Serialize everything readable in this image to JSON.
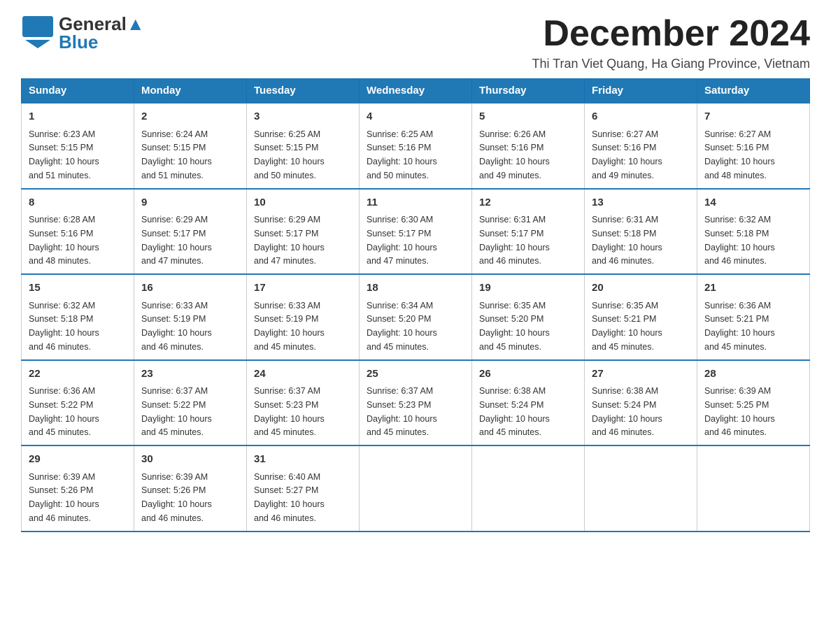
{
  "logo": {
    "general": "General",
    "blue": "Blue"
  },
  "header": {
    "month_title": "December 2024",
    "location": "Thi Tran Viet Quang, Ha Giang Province, Vietnam"
  },
  "weekdays": [
    "Sunday",
    "Monday",
    "Tuesday",
    "Wednesday",
    "Thursday",
    "Friday",
    "Saturday"
  ],
  "weeks": [
    [
      {
        "day": "1",
        "sunrise": "6:23 AM",
        "sunset": "5:15 PM",
        "daylight": "10 hours and 51 minutes."
      },
      {
        "day": "2",
        "sunrise": "6:24 AM",
        "sunset": "5:15 PM",
        "daylight": "10 hours and 51 minutes."
      },
      {
        "day": "3",
        "sunrise": "6:25 AM",
        "sunset": "5:15 PM",
        "daylight": "10 hours and 50 minutes."
      },
      {
        "day": "4",
        "sunrise": "6:25 AM",
        "sunset": "5:16 PM",
        "daylight": "10 hours and 50 minutes."
      },
      {
        "day": "5",
        "sunrise": "6:26 AM",
        "sunset": "5:16 PM",
        "daylight": "10 hours and 49 minutes."
      },
      {
        "day": "6",
        "sunrise": "6:27 AM",
        "sunset": "5:16 PM",
        "daylight": "10 hours and 49 minutes."
      },
      {
        "day": "7",
        "sunrise": "6:27 AM",
        "sunset": "5:16 PM",
        "daylight": "10 hours and 48 minutes."
      }
    ],
    [
      {
        "day": "8",
        "sunrise": "6:28 AM",
        "sunset": "5:16 PM",
        "daylight": "10 hours and 48 minutes."
      },
      {
        "day": "9",
        "sunrise": "6:29 AM",
        "sunset": "5:17 PM",
        "daylight": "10 hours and 47 minutes."
      },
      {
        "day": "10",
        "sunrise": "6:29 AM",
        "sunset": "5:17 PM",
        "daylight": "10 hours and 47 minutes."
      },
      {
        "day": "11",
        "sunrise": "6:30 AM",
        "sunset": "5:17 PM",
        "daylight": "10 hours and 47 minutes."
      },
      {
        "day": "12",
        "sunrise": "6:31 AM",
        "sunset": "5:17 PM",
        "daylight": "10 hours and 46 minutes."
      },
      {
        "day": "13",
        "sunrise": "6:31 AM",
        "sunset": "5:18 PM",
        "daylight": "10 hours and 46 minutes."
      },
      {
        "day": "14",
        "sunrise": "6:32 AM",
        "sunset": "5:18 PM",
        "daylight": "10 hours and 46 minutes."
      }
    ],
    [
      {
        "day": "15",
        "sunrise": "6:32 AM",
        "sunset": "5:18 PM",
        "daylight": "10 hours and 46 minutes."
      },
      {
        "day": "16",
        "sunrise": "6:33 AM",
        "sunset": "5:19 PM",
        "daylight": "10 hours and 46 minutes."
      },
      {
        "day": "17",
        "sunrise": "6:33 AM",
        "sunset": "5:19 PM",
        "daylight": "10 hours and 45 minutes."
      },
      {
        "day": "18",
        "sunrise": "6:34 AM",
        "sunset": "5:20 PM",
        "daylight": "10 hours and 45 minutes."
      },
      {
        "day": "19",
        "sunrise": "6:35 AM",
        "sunset": "5:20 PM",
        "daylight": "10 hours and 45 minutes."
      },
      {
        "day": "20",
        "sunrise": "6:35 AM",
        "sunset": "5:21 PM",
        "daylight": "10 hours and 45 minutes."
      },
      {
        "day": "21",
        "sunrise": "6:36 AM",
        "sunset": "5:21 PM",
        "daylight": "10 hours and 45 minutes."
      }
    ],
    [
      {
        "day": "22",
        "sunrise": "6:36 AM",
        "sunset": "5:22 PM",
        "daylight": "10 hours and 45 minutes."
      },
      {
        "day": "23",
        "sunrise": "6:37 AM",
        "sunset": "5:22 PM",
        "daylight": "10 hours and 45 minutes."
      },
      {
        "day": "24",
        "sunrise": "6:37 AM",
        "sunset": "5:23 PM",
        "daylight": "10 hours and 45 minutes."
      },
      {
        "day": "25",
        "sunrise": "6:37 AM",
        "sunset": "5:23 PM",
        "daylight": "10 hours and 45 minutes."
      },
      {
        "day": "26",
        "sunrise": "6:38 AM",
        "sunset": "5:24 PM",
        "daylight": "10 hours and 45 minutes."
      },
      {
        "day": "27",
        "sunrise": "6:38 AM",
        "sunset": "5:24 PM",
        "daylight": "10 hours and 46 minutes."
      },
      {
        "day": "28",
        "sunrise": "6:39 AM",
        "sunset": "5:25 PM",
        "daylight": "10 hours and 46 minutes."
      }
    ],
    [
      {
        "day": "29",
        "sunrise": "6:39 AM",
        "sunset": "5:26 PM",
        "daylight": "10 hours and 46 minutes."
      },
      {
        "day": "30",
        "sunrise": "6:39 AM",
        "sunset": "5:26 PM",
        "daylight": "10 hours and 46 minutes."
      },
      {
        "day": "31",
        "sunrise": "6:40 AM",
        "sunset": "5:27 PM",
        "daylight": "10 hours and 46 minutes."
      },
      null,
      null,
      null,
      null
    ]
  ],
  "labels": {
    "sunrise": "Sunrise:",
    "sunset": "Sunset:",
    "daylight": "Daylight:"
  }
}
